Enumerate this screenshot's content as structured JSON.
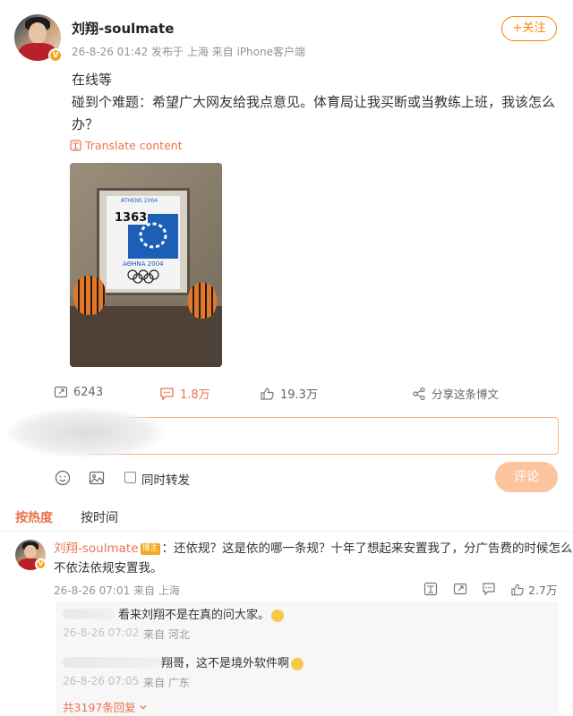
{
  "post": {
    "username": "刘翔-soulmate",
    "meta": "26-8-26 01:42 发布于 上海 来自 iPhone客户端",
    "follow_label": "+关注",
    "lines": [
      "在线等",
      "碰到个难题：希望广大网友给我点意见。体育局让我买断或当教练上班，我该怎么",
      "办？"
    ],
    "translate_label": "Translate content",
    "photo": {
      "bib_number": "1363",
      "banner": "ATHENS 2004",
      "caption": "AΘHNA 2004"
    }
  },
  "actions": {
    "repost": "6243",
    "comments": "1.8万",
    "likes": "19.3万",
    "share": "分享这条博文"
  },
  "composer": {
    "forward_label": "同时转发",
    "submit_label": "评论"
  },
  "tabs": {
    "hot": "按热度",
    "time": "按时间"
  },
  "comment": {
    "user": "刘翔-soulmate",
    "tag": "博主",
    "line1": "：还依规？这是依的哪一条规？十年了想起来安置我了，分广告费的时候怎么",
    "line2": "不依法依规安置我。",
    "meta": "26-8-26 07:01 来自 上海",
    "likes": "2.7万"
  },
  "replies": [
    {
      "text": "看来刘翔不是在真的问大家。",
      "meta_date": "26-8-26 07:02",
      "meta_loc": "来自 河北"
    },
    {
      "text": "翔哥，这不是境外软件啊",
      "meta_date": "26-8-26 07:05",
      "meta_loc": "来自 广东"
    }
  ],
  "more_replies": "共3197条回复",
  "colors": {
    "accent": "#eb7350",
    "follow": "#ff8200",
    "vip": "#f5a623",
    "submit_bg": "#fcc59f"
  }
}
